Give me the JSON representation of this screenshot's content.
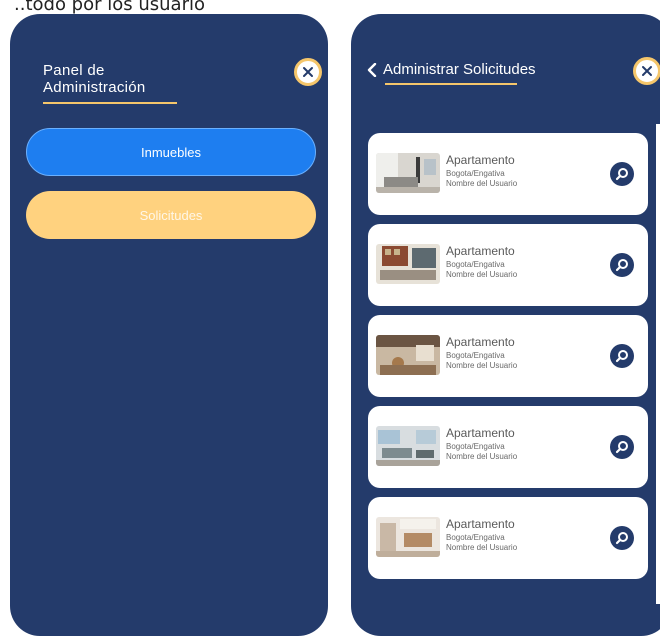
{
  "caption": "..todo por los usuario",
  "colors": {
    "panel_bg": "#243b6b",
    "accent_gold": "#f5c66b",
    "primary_blue": "#1e7ef0",
    "soft_yellow": "#ffd27f"
  },
  "left_panel": {
    "title_line1": "Panel de",
    "title_line2": "Administración",
    "close_icon": "close-icon",
    "buttons": {
      "inmuebles": "Inmuebles",
      "solicitudes": "Solicitudes"
    }
  },
  "right_panel": {
    "back_icon": "chevron-left-icon",
    "title": "Administrar Solicitudes",
    "close_icon": "close-icon",
    "cards": [
      {
        "type": "Apartamento",
        "location": "Bogota/Engativa",
        "user": "Nombre del Usuario"
      },
      {
        "type": "Apartamento",
        "location": "Bogota/Engativa",
        "user": "Nombre del Usuario"
      },
      {
        "type": "Apartamento",
        "location": "Bogota/Engativa",
        "user": "Nombre del Usuario"
      },
      {
        "type": "Apartamento",
        "location": "Bogota/Engativa",
        "user": "Nombre del Usuario"
      },
      {
        "type": "Apartamento",
        "location": "Bogota/Engativa",
        "user": "Nombre del Usuario"
      }
    ],
    "card_action_icon": "search-icon"
  }
}
